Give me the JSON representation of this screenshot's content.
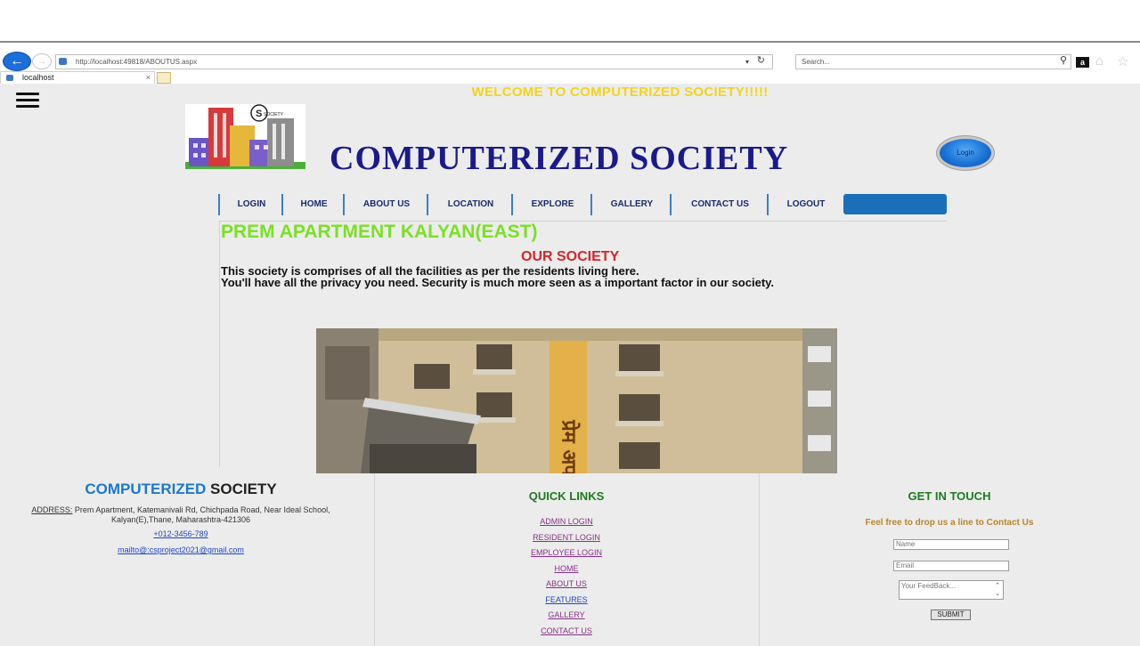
{
  "browser": {
    "url": "http://localhost:49818/ABOUTUS.aspx",
    "search_placeholder": "Search...",
    "tab_label": "localhost",
    "tab_close": "×"
  },
  "header": {
    "welcome": "WELCOME TO COMPUTERIZED SOCIETY!!!!!",
    "brand": "COMPUTERIZED SOCIETY",
    "login_button": "Login"
  },
  "nav": {
    "items": [
      "LOGIN",
      "HOME",
      "ABOUT US",
      "LOCATION",
      "EXPLORE",
      "GALLERY",
      "CONTACT US",
      "LOGOUT"
    ]
  },
  "content": {
    "heading": "PREM APARTMENT KALYAN(EAST)",
    "subheading": "OUR SOCIETY",
    "line1": "This society is comprises of all the facilities as per the residents living here.",
    "line2": "You'll have all the privacy you need. Security is much more seen as a important factor in our society.",
    "sign_text": "प्रेम अपार्टमेंट"
  },
  "footer": {
    "brand_part1": "COMPUTERIZED",
    "brand_part2": " SOCIETY",
    "address_label": "ADDRESS:",
    "address_line1": " Prem Apartment, Katemanivali Rd, Chichpada Road, Near Ideal School,",
    "address_line2": "Kalyan(E),Thane, Maharashtra-421306",
    "phone": "+012-3456-789",
    "email": "mailto@:csproject2021@gmail.com",
    "quick_links_title": "QUICK LINKS",
    "quick_links": [
      "ADMIN LOGIN",
      "RESIDENT LOGIN",
      "EMPLOYEE LOGIN",
      "HOME",
      "ABOUT US",
      "FEATURES",
      "GALLERY",
      "CONTACT US"
    ],
    "contact_title": "GET IN TOUCH",
    "contact_sub": "Feel free to drop us a line to Contact Us",
    "name_placeholder": "Name",
    "email_placeholder": "Email",
    "feedback_placeholder": "Your FeedBack...",
    "submit": "SUBMIT"
  },
  "colors": {
    "welcome": "#f2d41a",
    "brand": "#1a1a8c",
    "heading": "#7be025",
    "subheading": "#d4262a",
    "nav_accent": "#1b6fb8",
    "footer_title_green": "#1f7a1f"
  }
}
